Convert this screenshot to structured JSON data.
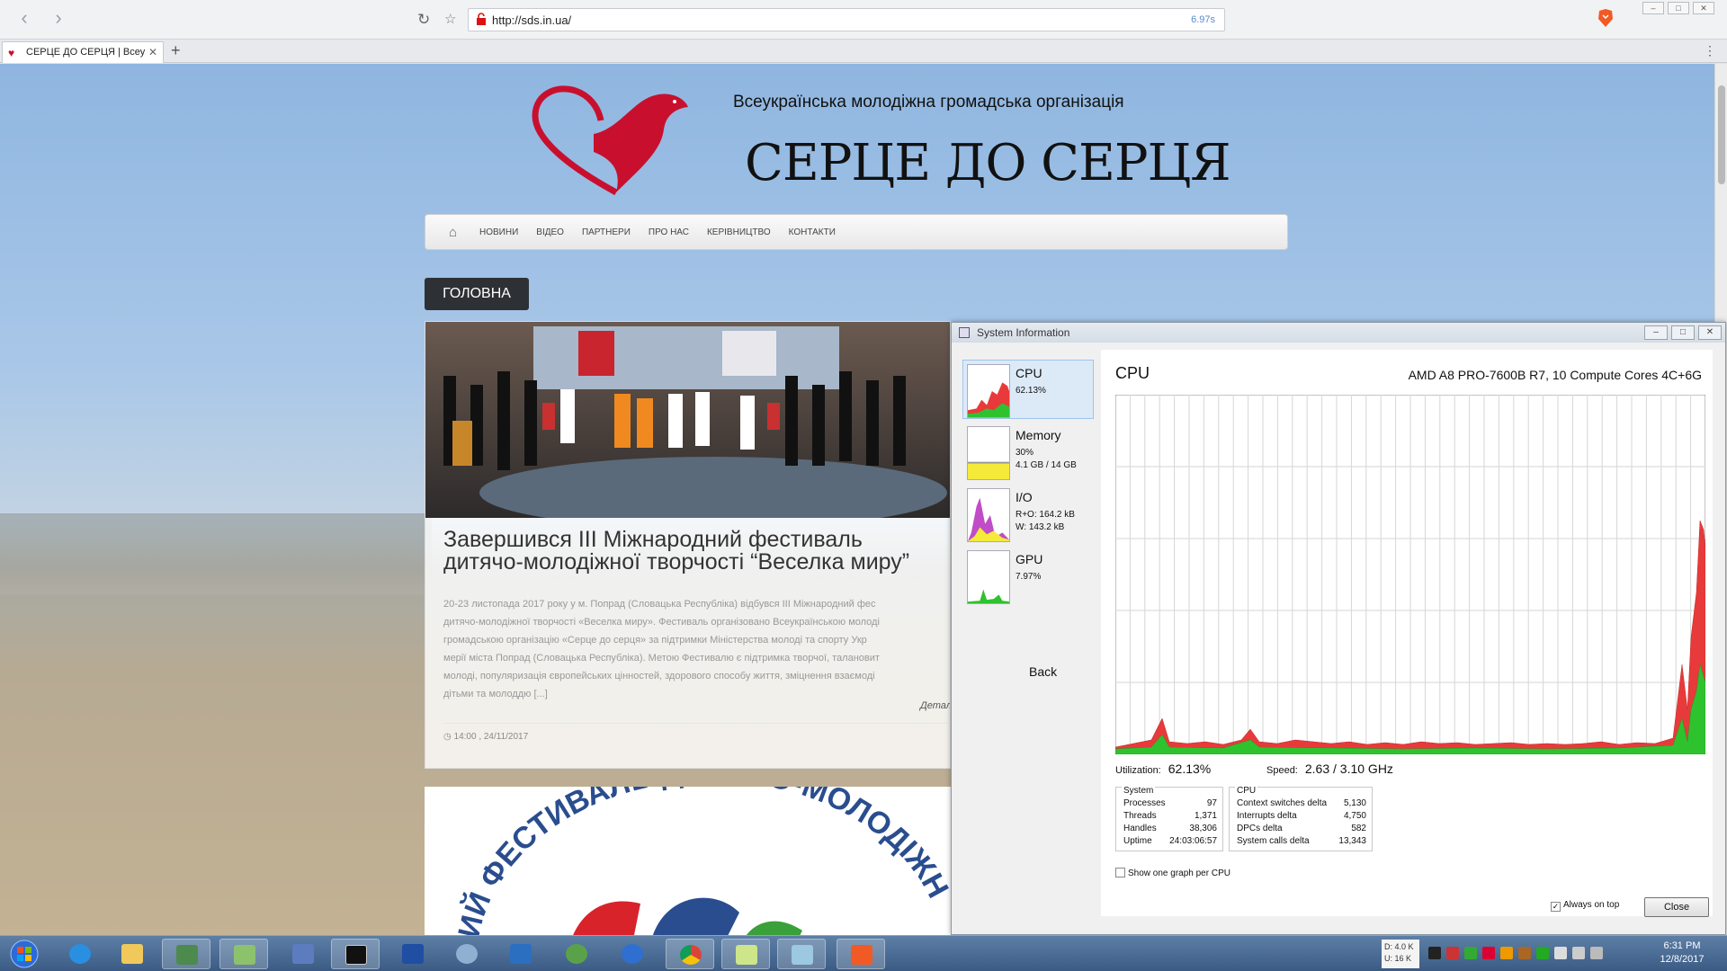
{
  "browser": {
    "url": "http://sds.in.ua/",
    "load_time": "6.97s",
    "tab_title": "СЕРЦЕ ДО СЕРЦЯ | Всеу"
  },
  "site": {
    "subtitle": "Всеукраїнська молодіжна громадська організація",
    "title": "СЕРЦЕ ДО СЕРЦЯ",
    "nav": [
      "НОВИНИ",
      "ВІДЕО",
      "ПАРТНЕРИ",
      "ПРО НАС",
      "КЕРІВНИЦТВО",
      "КОНТАКТИ"
    ],
    "page_heading": "ГОЛОВНА",
    "post": {
      "title": "Завершився ІІІ Міжнародний фестиваль дитячо-молодіжної творчості “Веселка миру”",
      "excerpt": [
        "20-23 листопада 2017 року у м. Попрад (Словацька Республіка) відбувся ІІІ Міжнародний фес",
        "дитячо-молодіжної творчості «Веселка миру». Фестиваль організовано Всеукраїнською молоді",
        "громадською організацію «Серце до серця» за підтримки Міністерства молоді та спорту Укр",
        "мерії міста Попрад (Словацька Республіка). Метою Фестивалю є підтримка творчої, талановит",
        "молоді, популяризація європейських цінностей, здорового способу життя, зміцнення взаємоді",
        "дітьми та молоддю [...]"
      ],
      "more": "Детал",
      "meta": "14:00 , 24/11/2017"
    },
    "banner_text": "ИЙ ФЕСТИВАЛЬ ДИТЯЧО-МОЛОДІЖНОЇ"
  },
  "sysinfo": {
    "window_title": "System Information",
    "items": [
      {
        "name": "CPU",
        "v1": "62.13%",
        "v2": ""
      },
      {
        "name": "Memory",
        "v1": "30%",
        "v2": "4.1 GB / 14 GB"
      },
      {
        "name": "I/O",
        "v1": "R+O: 164.2 kB",
        "v2": "W: 143.2 kB"
      },
      {
        "name": "GPU",
        "v1": "7.97%",
        "v2": ""
      }
    ],
    "back": "Back",
    "header": "CPU",
    "processor": "AMD A8 PRO-7600B R7, 10 Compute Cores 4C+6G",
    "utilization_label": "Utilization:",
    "utilization": "62.13%",
    "speed_label": "Speed:",
    "speed": "2.63 / 3.10 GHz",
    "system_group": {
      "legend": "System",
      "rows": [
        {
          "label": "Processes",
          "value": "97"
        },
        {
          "label": "Threads",
          "value": "1,371"
        },
        {
          "label": "Handles",
          "value": "38,306"
        },
        {
          "label": "Uptime",
          "value": "24:03:06:57"
        }
      ]
    },
    "cpu_group": {
      "legend": "CPU",
      "rows": [
        {
          "label": "Context switches delta",
          "value": "5,130"
        },
        {
          "label": "Interrupts delta",
          "value": "4,750"
        },
        {
          "label": "DPCs delta",
          "value": "582"
        },
        {
          "label": "System calls delta",
          "value": "13,343"
        }
      ]
    },
    "show_one_graph": "Show one graph per CPU",
    "always_on_top": "Always on top",
    "close": "Close",
    "colors": {
      "kernel": "#e83a3a",
      "user": "#2fc22f"
    }
  },
  "taskbar": {
    "net_down": "D: 4.0 K",
    "net_up": "U: 16 K",
    "time": "6:31 PM",
    "date": "12/8/2017"
  }
}
